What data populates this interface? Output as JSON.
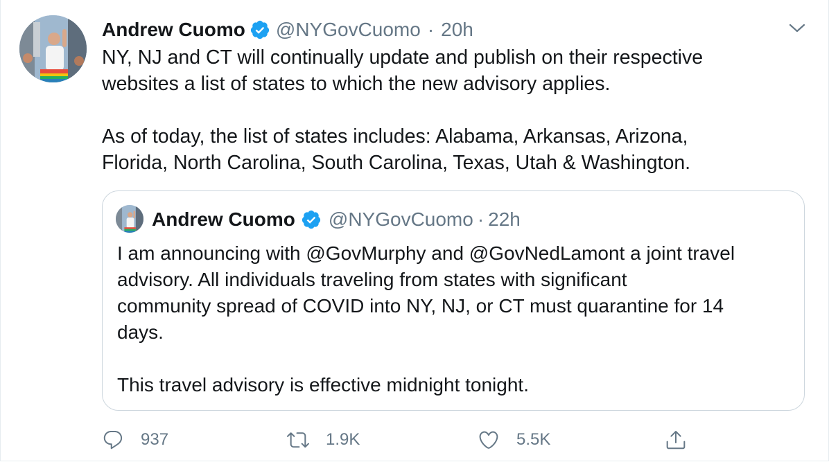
{
  "tweet": {
    "author_name": "Andrew Cuomo",
    "handle": "@NYGovCuomo",
    "separator": "·",
    "time": "20h",
    "text": "NY, NJ and CT will continually update and publish on their respective\nwebsites a list of states to which the new advisory applies.\n\nAs of today, the list of states includes: Alabama, Arkansas, Arizona,\nFlorida, North Carolina, South Carolina, Texas, Utah & Washington."
  },
  "quoted_tweet": {
    "author_name": "Andrew Cuomo",
    "handle": "@NYGovCuomo",
    "separator": "·",
    "time": "22h",
    "text": "I am announcing with @GovMurphy and @GovNedLamont a joint travel\nadvisory. All individuals traveling from states with significant\ncommunity spread of COVID into NY, NJ, or CT must quarantine for 14\ndays.\n\nThis travel advisory is effective midnight tonight."
  },
  "actions": {
    "reply_count": "937",
    "retweet_count": "1.9K",
    "like_count": "5.5K"
  },
  "icons": {
    "verified": "verified-badge-icon",
    "menu": "chevron-down-icon",
    "reply": "reply-icon",
    "retweet": "retweet-icon",
    "like": "heart-icon",
    "share": "share-icon"
  },
  "colors": {
    "verified_blue": "#1da1f2",
    "muted_text": "#657786",
    "text": "#14171a",
    "quote_border": "#ccd6dd"
  }
}
